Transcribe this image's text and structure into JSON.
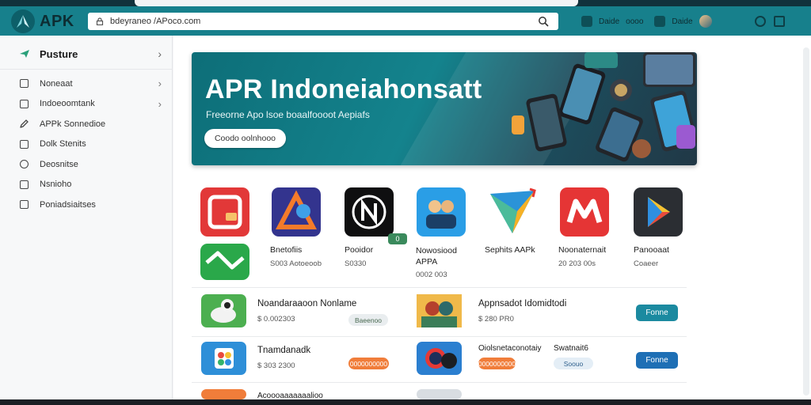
{
  "browser": {
    "brand": "APK",
    "url": "bdeyraneo /APoco.com",
    "header_right": [
      "Daide",
      "oooo",
      "Daide"
    ]
  },
  "sidebar": {
    "header_label": "Pusture",
    "items": [
      {
        "label": "Noneaat",
        "icon": "camera-icon",
        "chevron": true
      },
      {
        "label": "Indoeoomtank",
        "icon": "grid-icon",
        "chevron": true
      },
      {
        "label": "APPk Sonnedioe",
        "icon": "pencil-icon",
        "chevron": false
      },
      {
        "label": "Dolk Stenits",
        "icon": "window-icon",
        "chevron": false
      },
      {
        "label": "Deosnitse",
        "icon": "circle-icon",
        "chevron": false
      },
      {
        "label": "Nsnioho",
        "icon": "list-icon",
        "chevron": false
      },
      {
        "label": "Poniadsiaitses",
        "icon": "folder-icon",
        "chevron": false
      }
    ]
  },
  "hero": {
    "title": "APR Indoneiahonsatt",
    "subtitle": "Freeorne Apo lsoe boaalfoooot Aepiafs",
    "button_label": "Coodo oolnhooo"
  },
  "apps": [
    {
      "name": "",
      "sub": "",
      "icon": "red-square-app-icon",
      "color": "#e53935"
    },
    {
      "name": "Bnetofiis",
      "sub": "S003 Aotoeoob",
      "icon": "triangle-app-icon",
      "color": "#3b3b9a"
    },
    {
      "name": "Pooidor",
      "sub": "S0330",
      "icon": "n-letter-app-icon",
      "color": "#111111"
    },
    {
      "name": "Nowosiood APPA",
      "sub": "0002 003",
      "icon": "people-app-icon",
      "color": "#2aa2e8"
    },
    {
      "name": "Sephits AAPk",
      "sub": "",
      "icon": "paper-plane-app-icon",
      "color": "#f5a623"
    },
    {
      "name": "Noonaternait",
      "sub": "20 203 00s",
      "icon": "m-letter-app-icon",
      "color": "#e53935"
    },
    {
      "name": "Panooaat",
      "sub": "Coaeer",
      "icon": "play-store-app-icon",
      "color": "#2b2e33"
    },
    {
      "name": "",
      "sub": "",
      "icon": "green-wave-app-icon",
      "color": "#2eaa4a"
    }
  ],
  "app_badge": "0",
  "list": [
    {
      "title": "Noandaraaoon Nonlame",
      "meta": "$ 0.002303",
      "tag": "Baeenoo",
      "icon": "dog-app-icon"
    },
    {
      "title": "Appnsadot Idomidtodi",
      "meta": "$ 280 PR0",
      "button": "Fonne",
      "icon": "family-app-icon"
    },
    {
      "title": "Tnamdanadk",
      "meta": "$ 303 2300",
      "tag": "0000000000",
      "icon": "photos-app-icon"
    },
    {
      "title": "Oiolsnetaconotaiy",
      "meta": "",
      "tag": "0000000000",
      "icon": "chat-app-icon"
    },
    {
      "title": "Swatnait6",
      "meta": "",
      "tag": "Soouo",
      "button": "Fonne"
    }
  ],
  "partial_row": {
    "title": "Acoooaaaaaaalioo"
  },
  "colors": {
    "header": "#17808c",
    "teal_button": "#1b8aa0",
    "blue_button": "#1e6fb5",
    "orange": "#f07d3a"
  }
}
